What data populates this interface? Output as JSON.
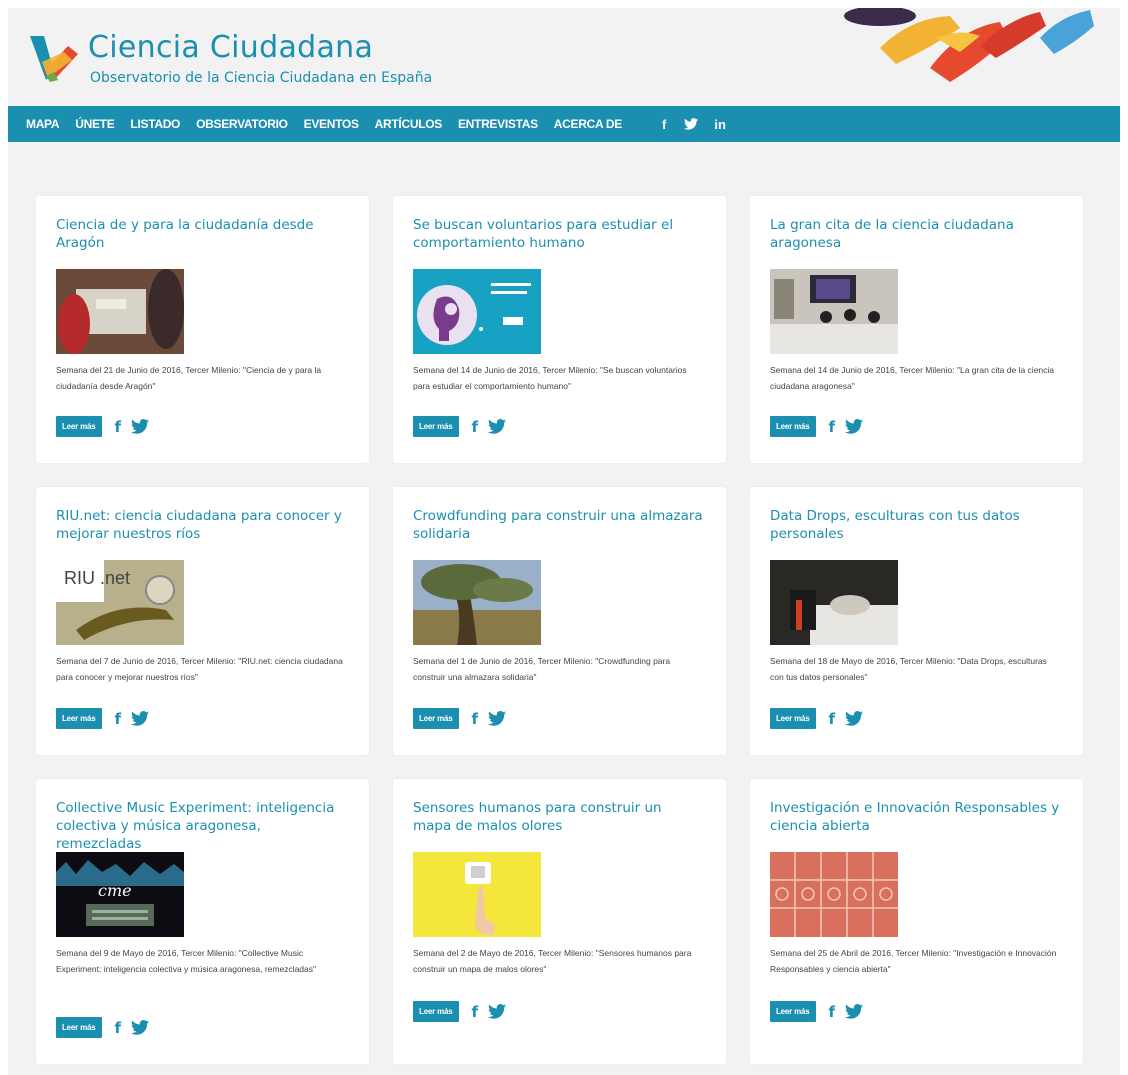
{
  "header": {
    "title": "Ciencia Ciudadana",
    "subtitle": "Observatorio de la Ciencia Ciudadana en España",
    "brand_color": "#1a8fb0"
  },
  "nav": {
    "items": [
      "MAPA",
      "ÚNETE",
      "LISTADO",
      "OBSERVATORIO",
      "EVENTOS",
      "ARTÍCULOS",
      "ENTREVISTAS",
      "ACERCA DE"
    ],
    "social": [
      "f",
      "twitter",
      "in"
    ]
  },
  "cards": [
    {
      "title": "Ciencia de y para la ciudadanía desde Aragón",
      "text": "Semana del 21 de Junio de 2016, Tercer Milenio: \"Ciencia de y para la ciudadanía desde Aragón\"",
      "button": "Leer más"
    },
    {
      "title": "Se buscan voluntarios para estudiar el comportamiento humano",
      "text": "Semana del 14 de Junio de 2016, Tercer Milenio: \"Se buscan voluntarios para estudiar el comportamiento humano\"",
      "button": "Leer más"
    },
    {
      "title": "La gran cita de la ciencia ciudadana aragonesa",
      "text": "Semana del 14 de Junio de 2016, Tercer Milenio: \"La gran cita de la ciencia ciudadana aragonesa\"",
      "button": "Leer más"
    },
    {
      "title": "RIU.net: ciencia ciudadana para conocer y mejorar nuestros ríos",
      "text": "Semana del 7 de Junio de 2016, Tercer Milenio: \"RIU.net: ciencia ciudadana para conocer y mejorar nuestros ríos\"",
      "button": "Leer más",
      "image_text": "RIU .net"
    },
    {
      "title": "Crowdfunding para construir una almazara solidaria",
      "text": "Semana del 1 de Junio de 2016, Tercer Milenio: \"Crowdfunding para construir una almazara solidaria\"",
      "button": "Leer más"
    },
    {
      "title": "Data Drops, esculturas con tus datos personales",
      "text": "Semana del 18 de Mayo de 2016, Tercer Milenio: \"Data Drops, esculturas con tus datos personales\"",
      "button": "Leer más"
    },
    {
      "title": "Collective Music Experiment: inteligencia colectiva y música aragonesa, remezcladas",
      "text": "Semana del 9 de Mayo de 2016, Tercer Milenio: \"Collective Music Experiment: inteligencia colectiva y música aragonesa, remezcladas\"",
      "button": "Leer más",
      "image_text": "cme"
    },
    {
      "title": "Sensores humanos para construir un mapa de malos olores",
      "text": "Semana del 2 de Mayo de 2016, Tercer Milenio: \"Sensores humanos para construir un mapa de malos olores\"",
      "button": "Leer más"
    },
    {
      "title": "Investigación e Innovación Responsables y ciencia abierta",
      "text": "Semana del 25 de Abril de 2016, Tercer Milenio: \"Investigación e Innovación Responsables y ciencia abierta\"",
      "button": "Leer más"
    }
  ]
}
